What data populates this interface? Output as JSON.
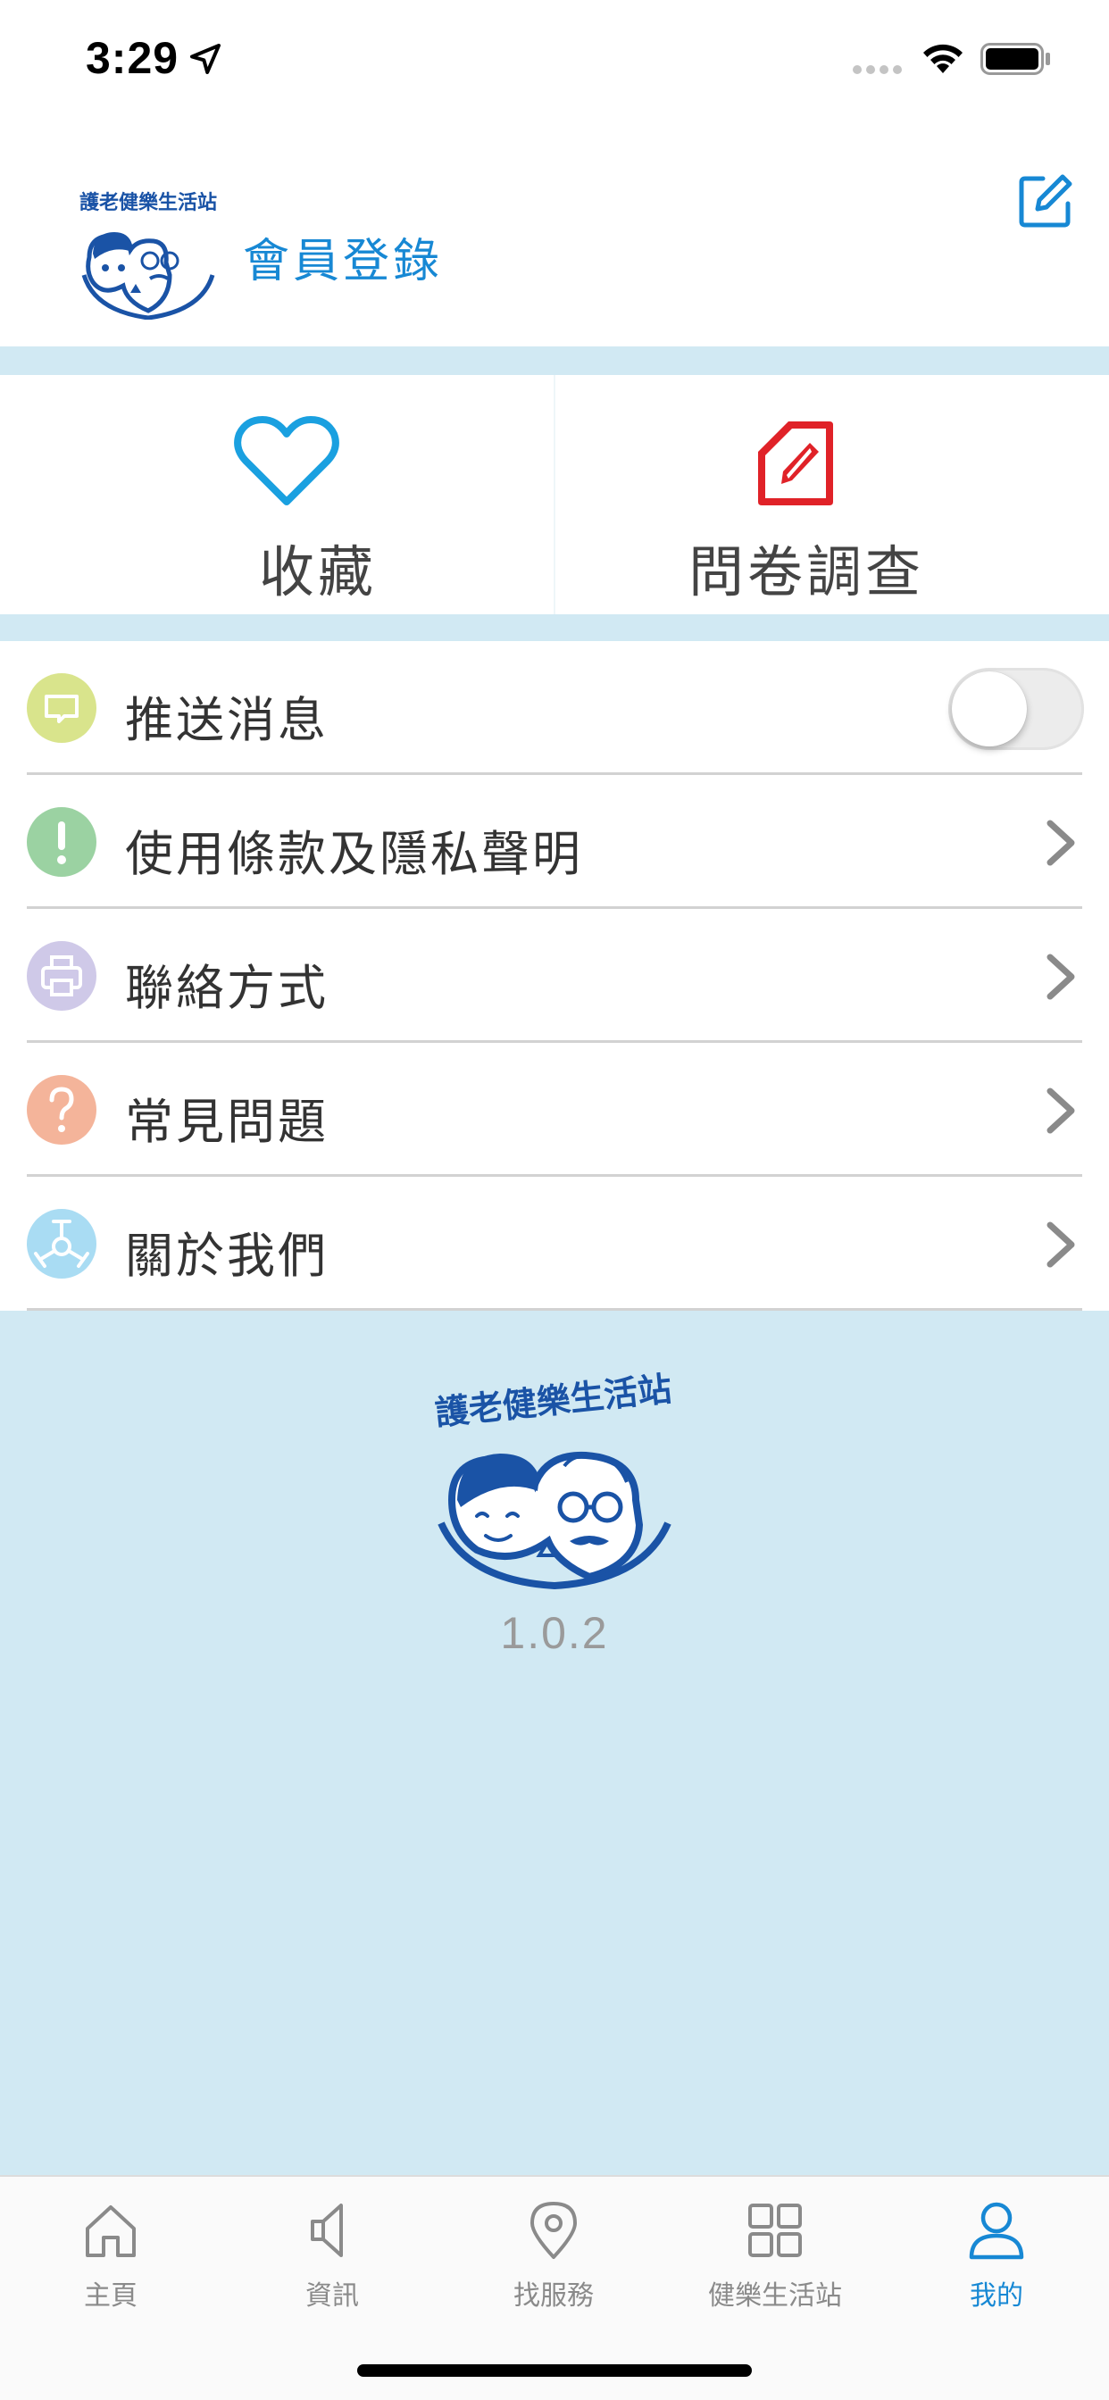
{
  "status_bar": {
    "time": "3:29"
  },
  "header": {
    "logo_text": "護老健樂生活站",
    "login_label": "會員登錄"
  },
  "quick_actions": [
    {
      "label": "收藏",
      "icon": "heart-icon",
      "color": "#1aa0e0"
    },
    {
      "label": "問卷調查",
      "icon": "survey-edit-icon",
      "color": "#e02228"
    }
  ],
  "settings": {
    "push": {
      "label": "推送消息",
      "icon": "message-icon",
      "icon_bg": "#d9e48c",
      "toggle_on": false
    },
    "items": [
      {
        "label": "使用條款及隱私聲明",
        "icon": "exclamation-icon",
        "icon_bg": "#9bd2a2"
      },
      {
        "label": "聯絡方式",
        "icon": "printer-icon",
        "icon_bg": "#cfc9e8"
      },
      {
        "label": "常見問題",
        "icon": "question-icon",
        "icon_bg": "#f4b49a"
      },
      {
        "label": "關於我們",
        "icon": "emblem-icon",
        "icon_bg": "#a9dcf3"
      }
    ]
  },
  "footer": {
    "logo_text": "護老健樂生活站",
    "version": "1.0.2"
  },
  "tabbar": {
    "active_color": "#1788d4",
    "inactive_color": "#8a8a8a",
    "tabs": [
      {
        "label": "主頁",
        "icon": "home-icon",
        "active": false
      },
      {
        "label": "資訊",
        "icon": "speaker-icon",
        "active": false
      },
      {
        "label": "找服務",
        "icon": "location-pin-icon",
        "active": false
      },
      {
        "label": "健樂生活站",
        "icon": "grid-icon",
        "active": false
      },
      {
        "label": "我的",
        "icon": "user-icon",
        "active": true
      }
    ]
  }
}
